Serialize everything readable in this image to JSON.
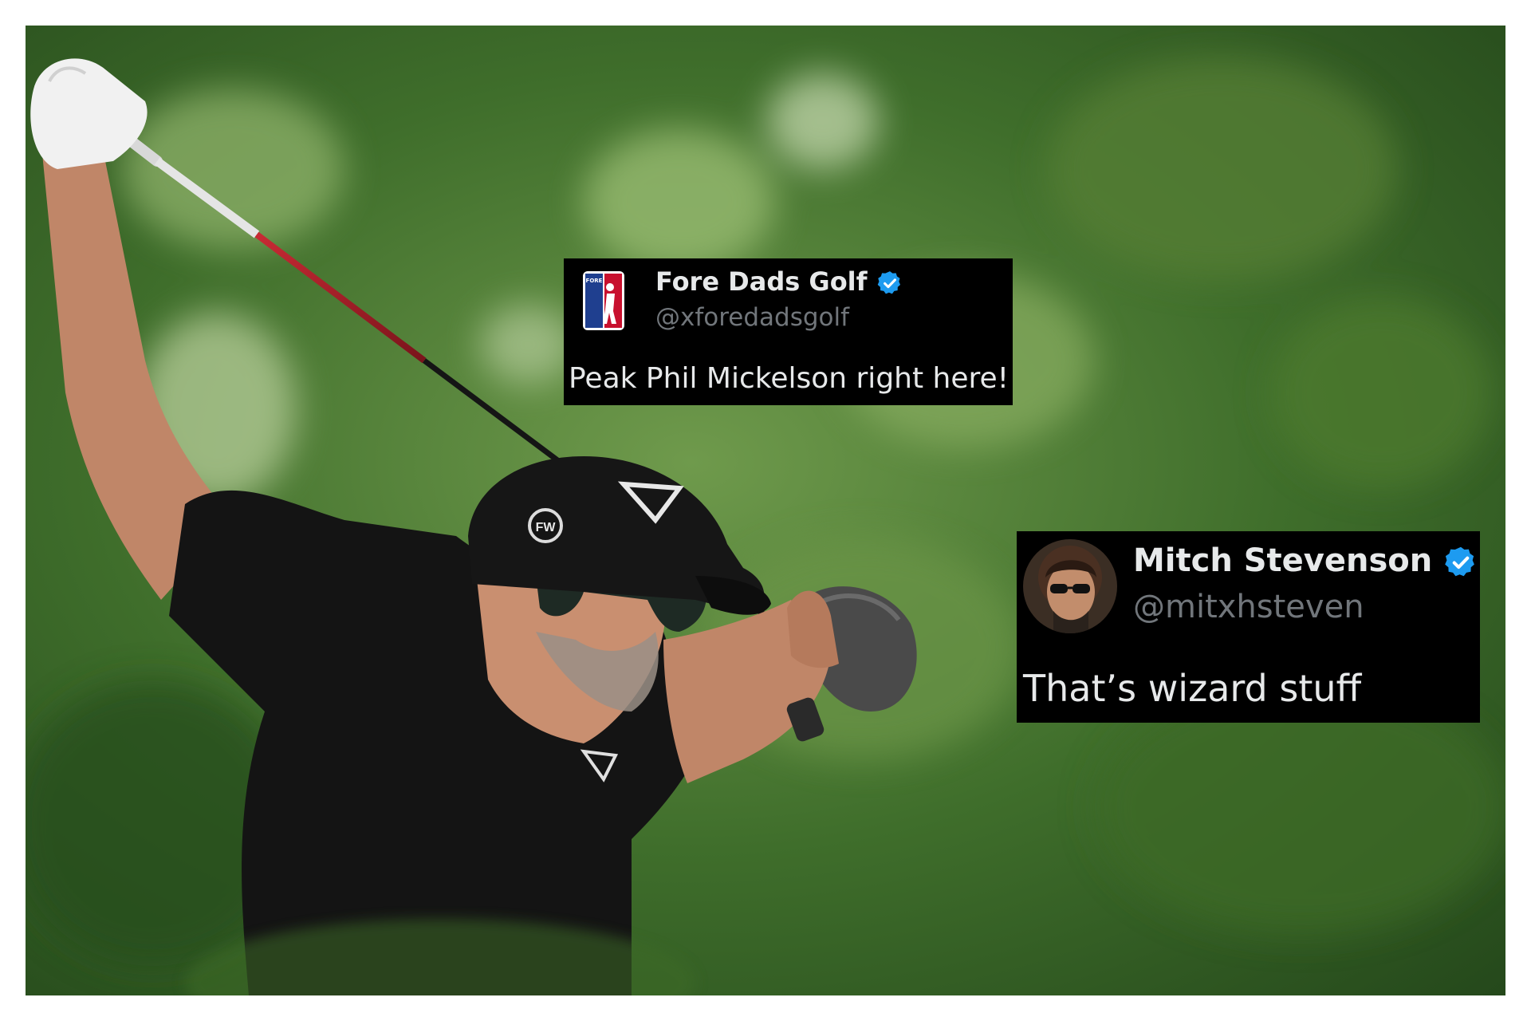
{
  "photo": {
    "subject": "golfer-follow-through",
    "cap_logo_text": "FW",
    "colors": {
      "background": "#3a6b2a",
      "shirt": "#141414",
      "shaft": "#b3202a",
      "glove": "#f1f1f1"
    }
  },
  "tweets": [
    {
      "name": "Fore Dads Golf",
      "handle": "@xforedadsgolf",
      "text": "Peak Phil Mickelson right here!",
      "verified": true,
      "avatar_logo_text": "FORE DADS"
    },
    {
      "name": "Mitch Stevenson",
      "handle": "@mitxhsteven",
      "text": "That’s wizard stuff",
      "verified": true
    }
  ],
  "colors": {
    "tweet_bg": "#000000",
    "name": "#e7e9ea",
    "handle": "#71767b",
    "verified": "#1d9bf0"
  }
}
